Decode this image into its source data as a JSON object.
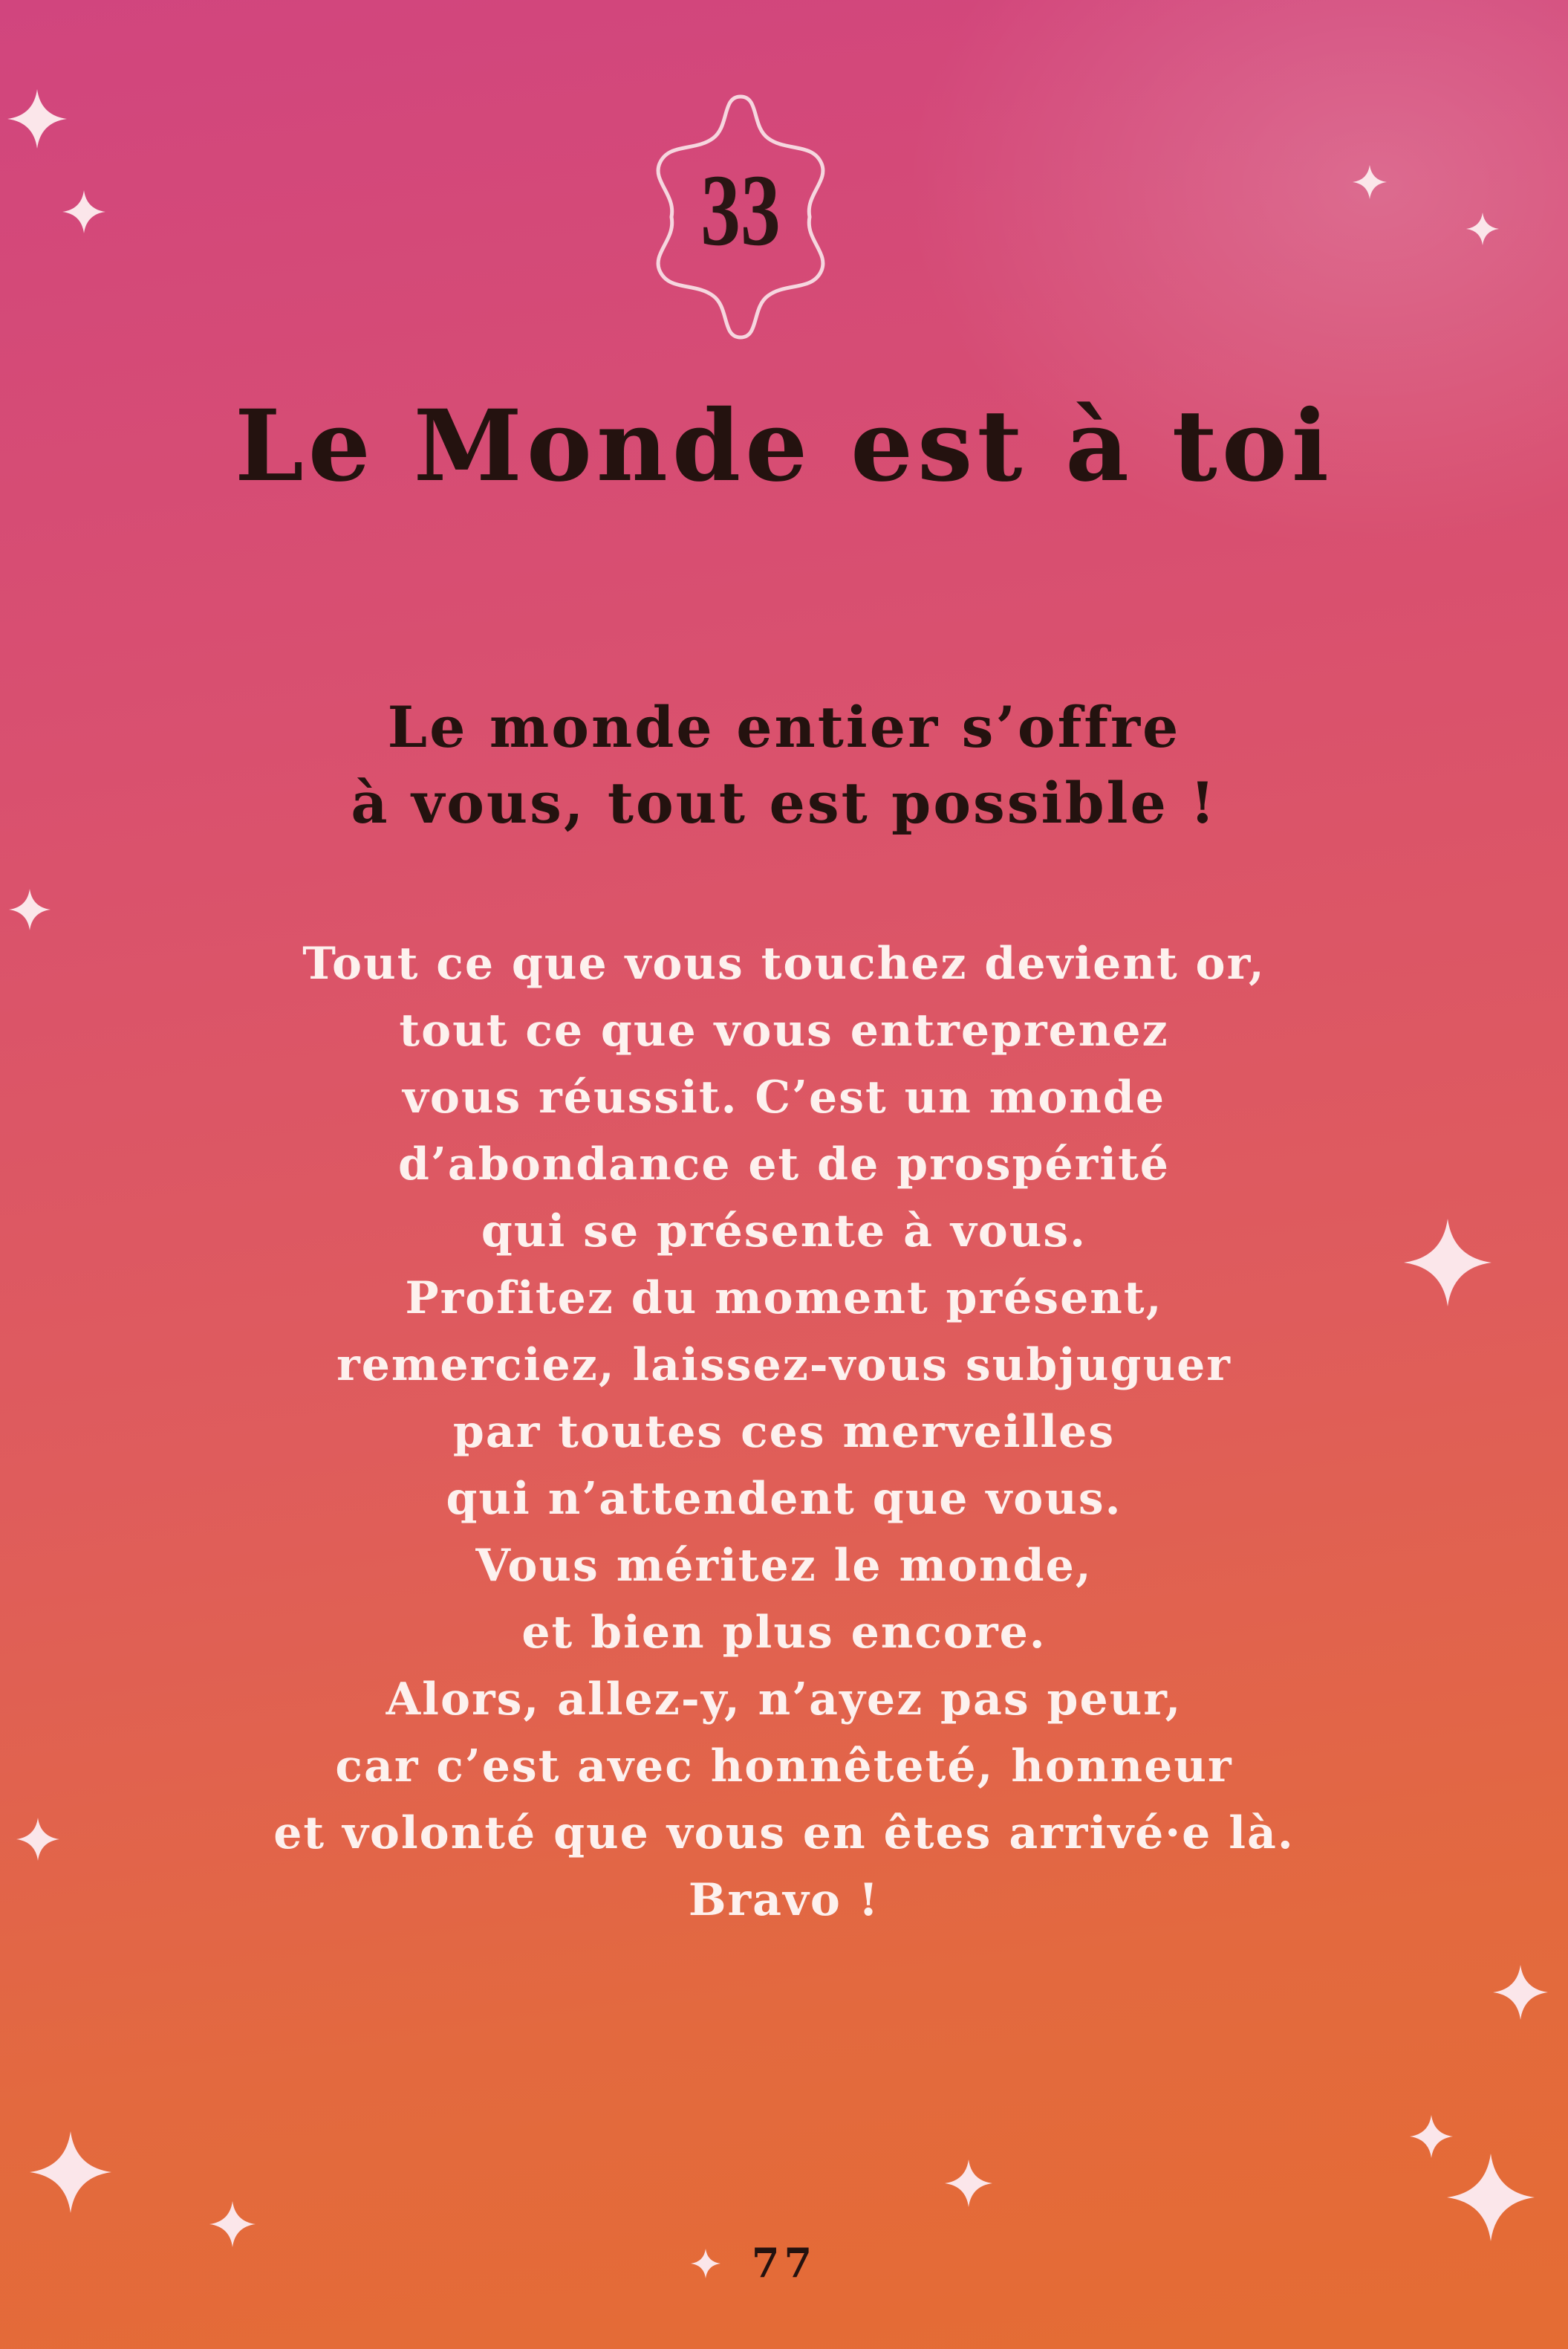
{
  "card_number": "33",
  "title": "Le Monde est à toi",
  "subtitle_lines": [
    "Le monde entier s’offre",
    "à vous, tout est possible !"
  ],
  "body_lines": [
    "Tout ce que vous touchez devient or,",
    "tout ce que vous entreprenez",
    "vous réussit. C’est un monde",
    "d’abondance et de prospérité",
    "qui se présente à vous.",
    "Profitez du moment présent,",
    "remerciez, laissez-vous subjuguer",
    "par toutes ces merveilles",
    "qui n’attendent que vous.",
    "Vous méritez le monde,",
    "et bien plus encore.",
    "Alors, allez-y, n’ayez pas peur,",
    "car c’est avec honnêteté, honneur",
    "et volonté que vous en êtes arrivé·e là.",
    "Bravo !"
  ],
  "page_number": "77",
  "decorations": {
    "sparkle_icon": "four-point-star-icon",
    "frame_icon": "wavy-diamond-frame-icon"
  },
  "colors": {
    "gradient_top": "#d1457e",
    "gradient_bottom": "#e46c33",
    "heading_text": "#24120f",
    "body_text": "#fdf1ee"
  }
}
